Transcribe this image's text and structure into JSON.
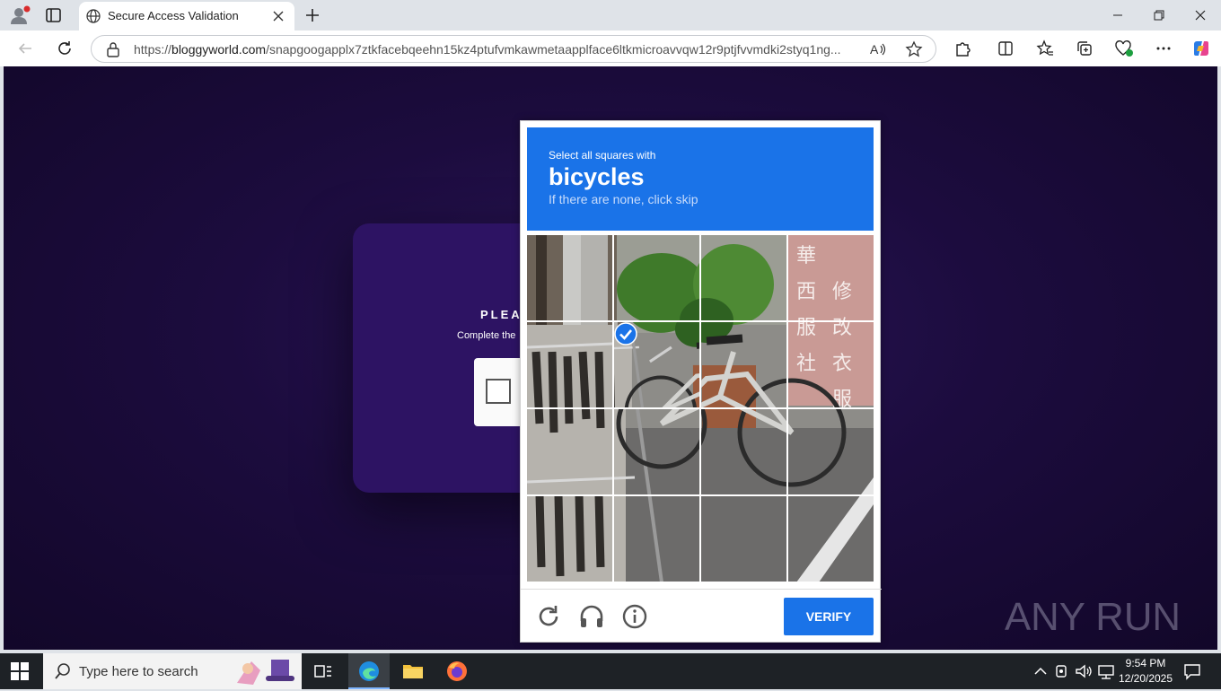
{
  "browser": {
    "tab_title": "Secure Access Validation",
    "url_prefix": "https://",
    "url_host": "bloggyworld.com",
    "url_path": "/snapgoogapplx7ztkfacebqeehn15kz4ptufvmkawmetaapplface6ltkmicroavvqw12r9ptjfvvmdki2styq1ng..."
  },
  "background_page": {
    "heading": "PLEAS",
    "subtext": "Complete the"
  },
  "captcha": {
    "instruction": "Select all squares with",
    "target": "bicycles",
    "hint": "If there are none, click skip",
    "verify_label": "VERIFY",
    "selected_tiles": [
      5
    ]
  },
  "watermark": "ANY RUN",
  "taskbar": {
    "search_placeholder": "Type here to search",
    "time": "9:54 PM",
    "date": "12/20/2025"
  },
  "colors": {
    "accent": "#1a73e8",
    "page_bg": "#1c0c3e"
  }
}
